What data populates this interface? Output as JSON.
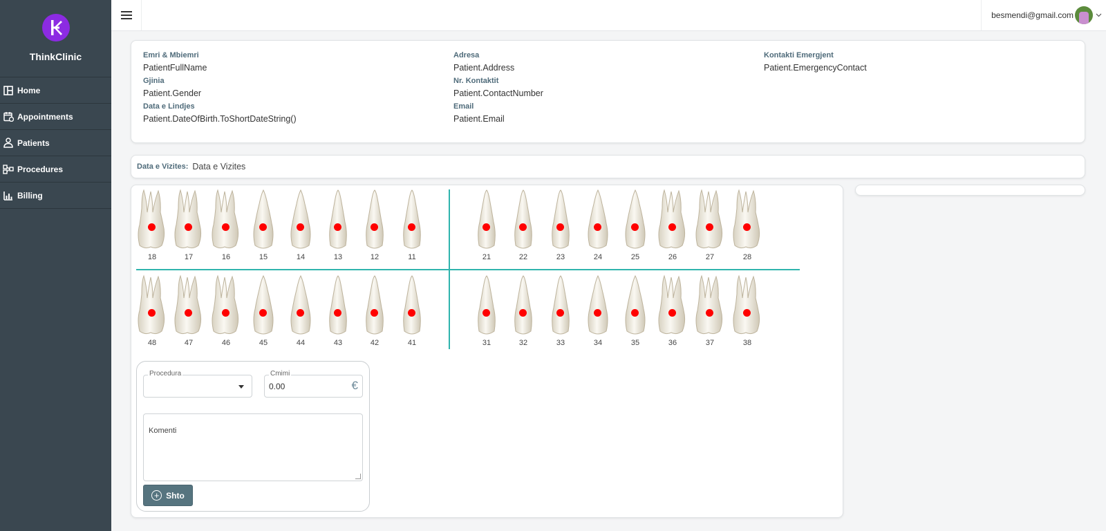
{
  "app": {
    "name": "ThinkClinic",
    "logo_letter": "K",
    "accent": "#8c2be2"
  },
  "sidebar": {
    "items": [
      {
        "label": "Home",
        "icon": "dashboard-icon"
      },
      {
        "label": "Appointments",
        "icon": "calendar-icon"
      },
      {
        "label": "Patients",
        "icon": "users-icon"
      },
      {
        "label": "Procedures",
        "icon": "sitemap-icon"
      },
      {
        "label": "Billing",
        "icon": "bar-chart-icon"
      }
    ]
  },
  "topbar": {
    "user_email": "besmendi@gmail.com"
  },
  "patient": {
    "name_label": "Emri & Mbiemri",
    "name_value": "PatientFullName",
    "gender_label": "Gjinia",
    "gender_value": "Patient.Gender",
    "dob_label": "Data e Lindjes",
    "dob_value": "Patient.DateOfBirth.ToShortDateString()",
    "address_label": "Adresa",
    "address_value": "Patient.Address",
    "contact_label": "Nr. Kontaktit",
    "contact_value": "Patient.ContactNumber",
    "email_label": "Email",
    "email_value": "Patient.Email",
    "emergency_label": "Kontakti Emergjent",
    "emergency_value": "Patient.EmergencyContact"
  },
  "visit": {
    "label": "Data e Vizites:",
    "value": "Data e Vizites"
  },
  "teeth": {
    "upper_right": [
      "18",
      "17",
      "16",
      "15",
      "14",
      "13",
      "12",
      "11"
    ],
    "upper_left": [
      "21",
      "22",
      "23",
      "24",
      "25",
      "26",
      "27",
      "28"
    ],
    "lower_right": [
      "48",
      "47",
      "46",
      "45",
      "44",
      "43",
      "42",
      "41"
    ],
    "lower_left": [
      "31",
      "32",
      "33",
      "34",
      "35",
      "36",
      "37",
      "38"
    ],
    "marker_color": "#ff0000",
    "divider_color": "#2fb4ad"
  },
  "form": {
    "procedure_label": "Procedura",
    "price_label": "Cmimi",
    "price_value": "0.00",
    "currency_symbol": "€",
    "comment_placeholder": "Komenti",
    "add_label": "Shto"
  }
}
